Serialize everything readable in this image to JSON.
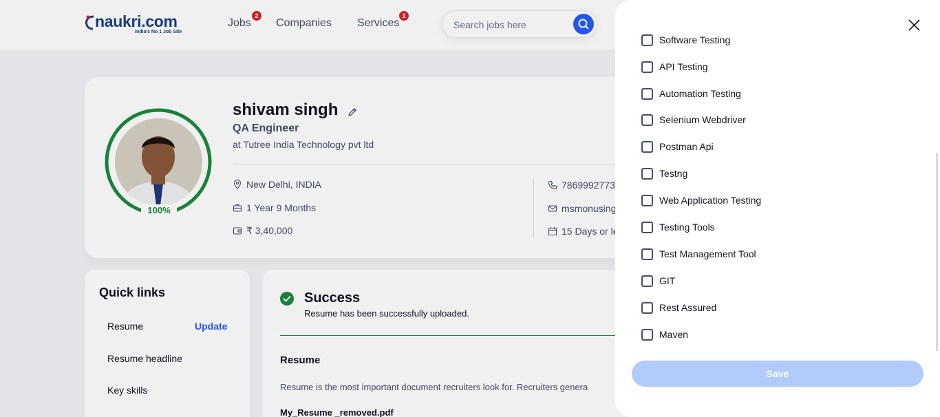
{
  "header": {
    "logo_word": "naukri.com",
    "logo_tagline": "India's No 1 Job Site",
    "nav": [
      {
        "label": "Jobs",
        "badge": "2"
      },
      {
        "label": "Companies",
        "badge": ""
      },
      {
        "label": "Services",
        "badge": "1"
      }
    ],
    "search_placeholder": "Search jobs here"
  },
  "profile": {
    "name": "shivam singh",
    "role": "QA Engineer",
    "company": "at Tutree India Technology pvt ltd",
    "completion": "100%",
    "location": "New Delhi, INDIA",
    "experience": "1 Year 9 Months",
    "salary": "₹ 3,40,000",
    "phone": "7869992773",
    "email": "msmonusing",
    "notice": "15 Days or le"
  },
  "quick_links": {
    "title": "Quick links",
    "items": [
      {
        "label": "Resume",
        "action": "Update"
      },
      {
        "label": "Resume headline",
        "action": ""
      },
      {
        "label": "Key skills",
        "action": ""
      }
    ]
  },
  "success": {
    "title": "Success",
    "message": "Resume has been successfully uploaded.",
    "section_title": "Resume",
    "description": "Resume is the most important document recruiters look for. Recruiters genera",
    "file_name": "My_Resume _removed.pdf"
  },
  "drawer": {
    "partial_item": "Software Testing",
    "skills": [
      "API Testing",
      "Automation Testing",
      "Selenium Webdriver",
      "Postman Api",
      "Testng",
      "Web Application Testing",
      "Testing Tools",
      "Test Management Tool",
      "GIT",
      "Rest Assured",
      "Maven"
    ],
    "save_label": "Save"
  },
  "colors": {
    "brand_blue": "#275df5",
    "success_green": "#1a8a3e",
    "badge_red": "#d8232a",
    "save_disabled": "#b1cbfa"
  }
}
